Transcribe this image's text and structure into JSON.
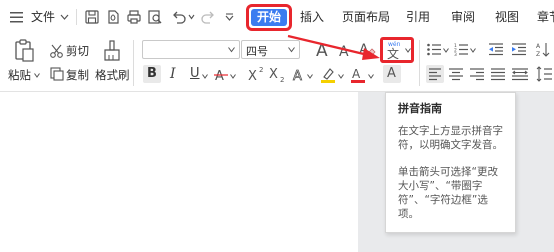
{
  "menu": {
    "file_label": "文件",
    "tabs": [
      "开始",
      "插入",
      "页面布局",
      "引用",
      "审阅",
      "视图",
      "章节"
    ]
  },
  "clipboard": {
    "paste_label": "粘贴",
    "cut_label": "剪切",
    "copy_label": "复制",
    "format_painter_label": "格式刷"
  },
  "font": {
    "family_value": "",
    "size_value": "四号"
  },
  "icons": {
    "pinyin_glyph_top": "wén",
    "pinyin_glyph_main": "文",
    "text_a": "A",
    "underline_u": "U",
    "bold_b": "B",
    "italic_i": "I"
  },
  "tooltip": {
    "title": "拼音指南",
    "line1": "在文字上方显示拼音字",
    "line2": "符，以明确文字发音。",
    "line3": "单击箭头可选择“更改",
    "line4": "大小写”、“带圈字",
    "line5": "符”、“字符边框”选",
    "line6": "项。"
  },
  "colors": {
    "accent_blue": "#3b7cf0",
    "highlight_red": "#e8262d",
    "font_color_red": "#e8262d",
    "highlight_yellow": "#f5d000"
  }
}
